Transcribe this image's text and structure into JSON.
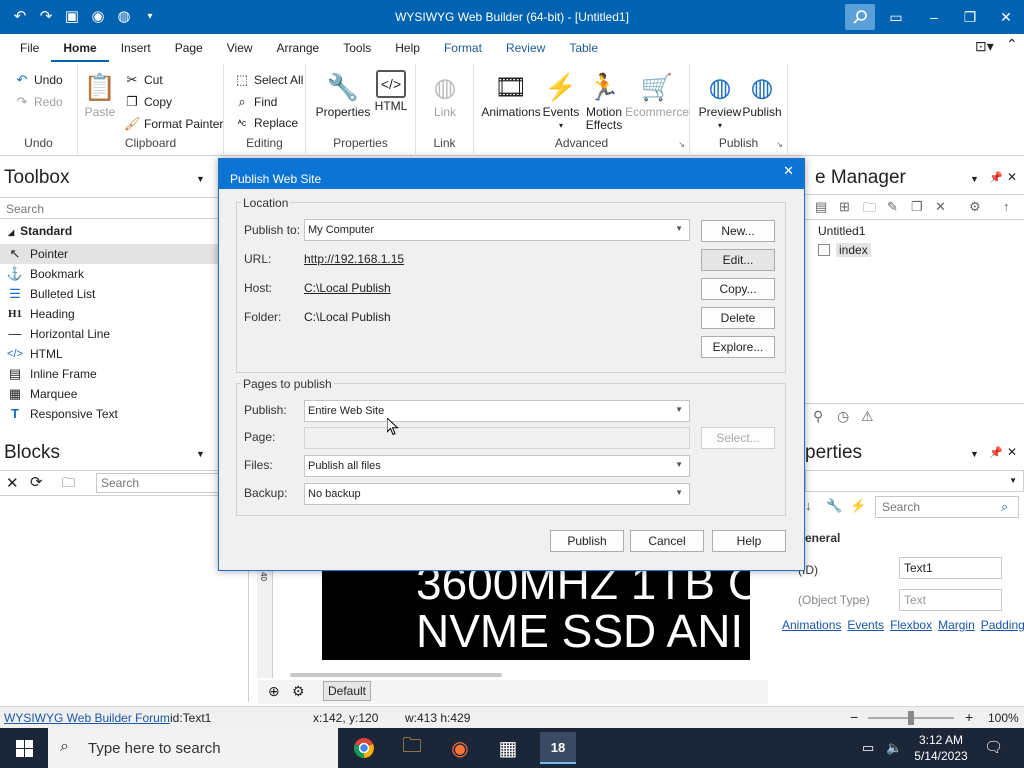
{
  "window": {
    "title": "WYSIWYG Web Builder (64-bit) - [Untitled1]"
  },
  "ribbon_tabs": [
    "File",
    "Home",
    "Insert",
    "Page",
    "View",
    "Arrange",
    "Tools",
    "Help",
    "Format",
    "Review",
    "Table"
  ],
  "ribbon": {
    "undo": "Undo",
    "redo": "Redo",
    "undo_group": "Undo",
    "paste": "Paste",
    "cut": "Cut",
    "copy": "Copy",
    "format_painter": "Format Painter",
    "clipboard_group": "Clipboard",
    "select_all": "Select All",
    "find": "Find",
    "replace": "Replace",
    "editing_group": "Editing",
    "properties": "Properties",
    "html": "HTML",
    "properties_group": "Properties",
    "link": "Link",
    "link_group": "Link",
    "animations": "Animations",
    "events": "Events",
    "motion_effects_1": "Motion",
    "motion_effects_2": "Effects",
    "ecommerce": "Ecommerce",
    "advanced_group": "Advanced",
    "preview": "Preview",
    "publish": "Publish",
    "publish_group": "Publish"
  },
  "toolbox": {
    "title": "Toolbox",
    "search_placeholder": "Search",
    "section": "Standard",
    "items": [
      {
        "label": "Pointer",
        "icon": "pointer-icon"
      },
      {
        "label": "Bookmark",
        "icon": "anchor-icon"
      },
      {
        "label": "Bulleted List",
        "icon": "list-icon"
      },
      {
        "label": "Heading",
        "icon": "heading-icon"
      },
      {
        "label": "Horizontal Line",
        "icon": "line-icon"
      },
      {
        "label": "HTML",
        "icon": "code-icon"
      },
      {
        "label": "Inline Frame",
        "icon": "frame-icon"
      },
      {
        "label": "Marquee",
        "icon": "marquee-icon"
      },
      {
        "label": "Responsive Text",
        "icon": "text-icon"
      }
    ]
  },
  "blocks": {
    "title": "Blocks",
    "search_placeholder": "Search"
  },
  "site_manager": {
    "title": "e Manager",
    "tree": [
      "Untitled1",
      "index"
    ]
  },
  "properties_panel": {
    "title": "perties",
    "search_placeholder": "Search",
    "section": "eneral",
    "id_label": "(ID)",
    "id_value": "Text1",
    "type_label": "(Object Type)",
    "type_value": "Text",
    "links": [
      "Animations",
      "Events",
      "Flexbox",
      "Margin",
      "Padding"
    ]
  },
  "canvas": {
    "text_line_1": "3600MHZ 1TB C",
    "text_line_2": "NVME SSD ANI",
    "ruler_mark": "40",
    "bottom_button": "Default"
  },
  "statusbar": {
    "forum_link": "WYSIWYG Web Builder Forum",
    "id": "id:Text1",
    "coords": "x:142, y:120",
    "size": "w:413 h:429",
    "zoom": "100%"
  },
  "taskbar": {
    "search_placeholder": "Type here to search",
    "time": "3:12 AM",
    "date": "5/14/2023"
  },
  "dialog": {
    "title": "Publish Web Site",
    "location_legend": "Location",
    "publish_to_label": "Publish to:",
    "publish_to_value": "My Computer",
    "url_label": "URL:",
    "url_value": "http://192.168.1.15",
    "host_label": "Host:",
    "host_value": "C:\\Local Publish",
    "folder_label": "Folder:",
    "folder_value": "C:\\Local Publish",
    "btn_new": "New...",
    "btn_edit": "Edit...",
    "btn_copy": "Copy...",
    "btn_delete": "Delete",
    "btn_explore": "Explore...",
    "pages_legend": "Pages to publish",
    "publish_label": "Publish:",
    "publish_value": "Entire Web Site",
    "page_label": "Page:",
    "page_value": "",
    "btn_select": "Select...",
    "files_label": "Files:",
    "files_value": "Publish all files",
    "backup_label": "Backup:",
    "backup_value": "No backup",
    "btn_publish": "Publish",
    "btn_cancel": "Cancel",
    "btn_help": "Help"
  },
  "colors": {
    "titlebar": "#0063b1",
    "dialog_title": "#0c74d5",
    "taskbar": "#1b2638"
  }
}
